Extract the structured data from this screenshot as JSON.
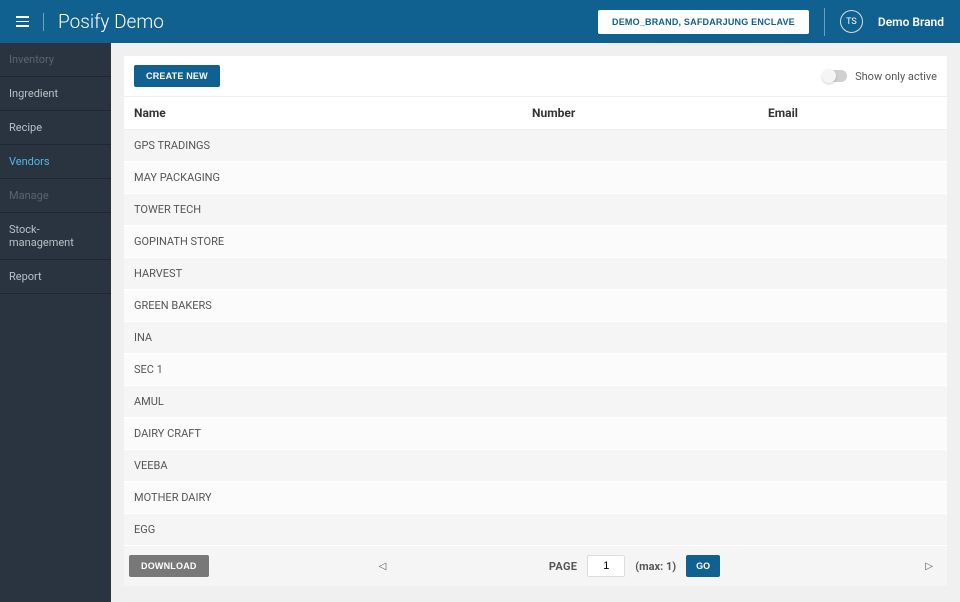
{
  "header": {
    "app_title": "Posify Demo",
    "location_button": "DEMO_BRAND, SAFDARJUNG ENCLAVE",
    "avatar_initials": "TS",
    "brand_name": "Demo Brand"
  },
  "sidebar": {
    "items": [
      {
        "label": "Inventory",
        "type": "header"
      },
      {
        "label": "Ingredient",
        "type": "link"
      },
      {
        "label": "Recipe",
        "type": "link"
      },
      {
        "label": "Vendors",
        "type": "link",
        "active": true
      },
      {
        "label": "Manage",
        "type": "header"
      },
      {
        "label": "Stock-management",
        "type": "link"
      },
      {
        "label": "Report",
        "type": "link"
      }
    ]
  },
  "toolbar": {
    "create_label": "CREATE NEW",
    "show_active_label": "Show only active"
  },
  "table": {
    "headers": {
      "name": "Name",
      "number": "Number",
      "email": "Email"
    },
    "rows": [
      {
        "name": "GPS TRADINGS",
        "number": "",
        "email": ""
      },
      {
        "name": "MAY PACKAGING",
        "number": "",
        "email": ""
      },
      {
        "name": "TOWER TECH",
        "number": "",
        "email": ""
      },
      {
        "name": "GOPINATH STORE",
        "number": "",
        "email": ""
      },
      {
        "name": "HARVEST",
        "number": "",
        "email": ""
      },
      {
        "name": "GREEN BAKERS",
        "number": "",
        "email": ""
      },
      {
        "name": "INA",
        "number": "",
        "email": ""
      },
      {
        "name": "SEC 1",
        "number": "",
        "email": ""
      },
      {
        "name": "AMUL",
        "number": "",
        "email": ""
      },
      {
        "name": "DAIRY CRAFT",
        "number": "",
        "email": ""
      },
      {
        "name": "VEEBA",
        "number": "",
        "email": ""
      },
      {
        "name": "MOTHER DAIRY",
        "number": "",
        "email": ""
      },
      {
        "name": "EGG",
        "number": "",
        "email": ""
      }
    ]
  },
  "footer": {
    "download_label": "DOWNLOAD",
    "page_label": "PAGE",
    "page_value": "1",
    "max_label": "(max: 1)",
    "go_label": "GO"
  }
}
